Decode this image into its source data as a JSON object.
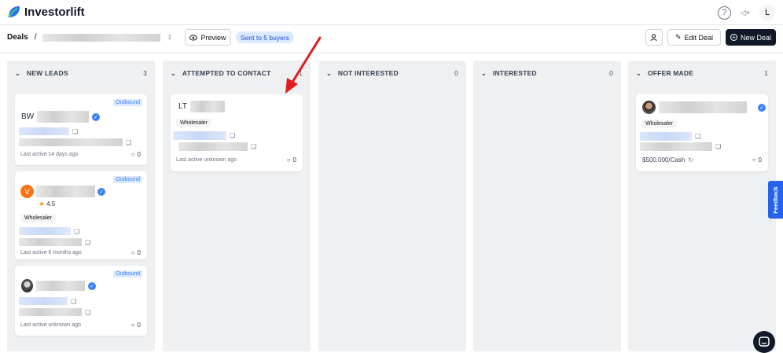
{
  "app": {
    "name": "Investorlift"
  },
  "topbar": {
    "help_icon": "?",
    "mute_icon": "◁×",
    "user_initial": "L"
  },
  "breadcrumb": {
    "root": "Deals",
    "separator": "/"
  },
  "actions": {
    "preview": "Preview",
    "sent_pill": "Sent to 5 buyers",
    "edit_deal": "Edit Deal",
    "new_deal": "New Deal"
  },
  "columns": [
    {
      "title": "NEW LEADS",
      "count": "3"
    },
    {
      "title": "ATTEMPTED TO CONTACT",
      "count": "1"
    },
    {
      "title": "NOT INTERESTED",
      "count": "0"
    },
    {
      "title": "INTERESTED",
      "count": "0"
    },
    {
      "title": "OFFER MADE",
      "count": "1"
    }
  ],
  "cards": {
    "nl1": {
      "initials": "BW",
      "badge": "Outbound",
      "last_active": "Last active 14 days ago",
      "comments": "0"
    },
    "nl2": {
      "initial": "V",
      "rating": "4.5",
      "badge": "Outbound",
      "tag": "Wholesaler",
      "last_active": "Last active 6 months ago",
      "comments": "0"
    },
    "nl3": {
      "badge": "Outbound",
      "last_active": "Last active unknown ago",
      "comments": "0"
    },
    "atc1": {
      "initials": "LT",
      "tag": "Wholesaler",
      "last_active": "Last active unknown ago",
      "comments": "0"
    },
    "om1": {
      "tag": "Wholesaler",
      "price": "$500,000/Cash",
      "comments": "0"
    }
  },
  "feedback": "Feedback",
  "colors": {
    "accent": "#3b82f6",
    "arrow": "#e11d1d",
    "dark_button": "#111827"
  }
}
